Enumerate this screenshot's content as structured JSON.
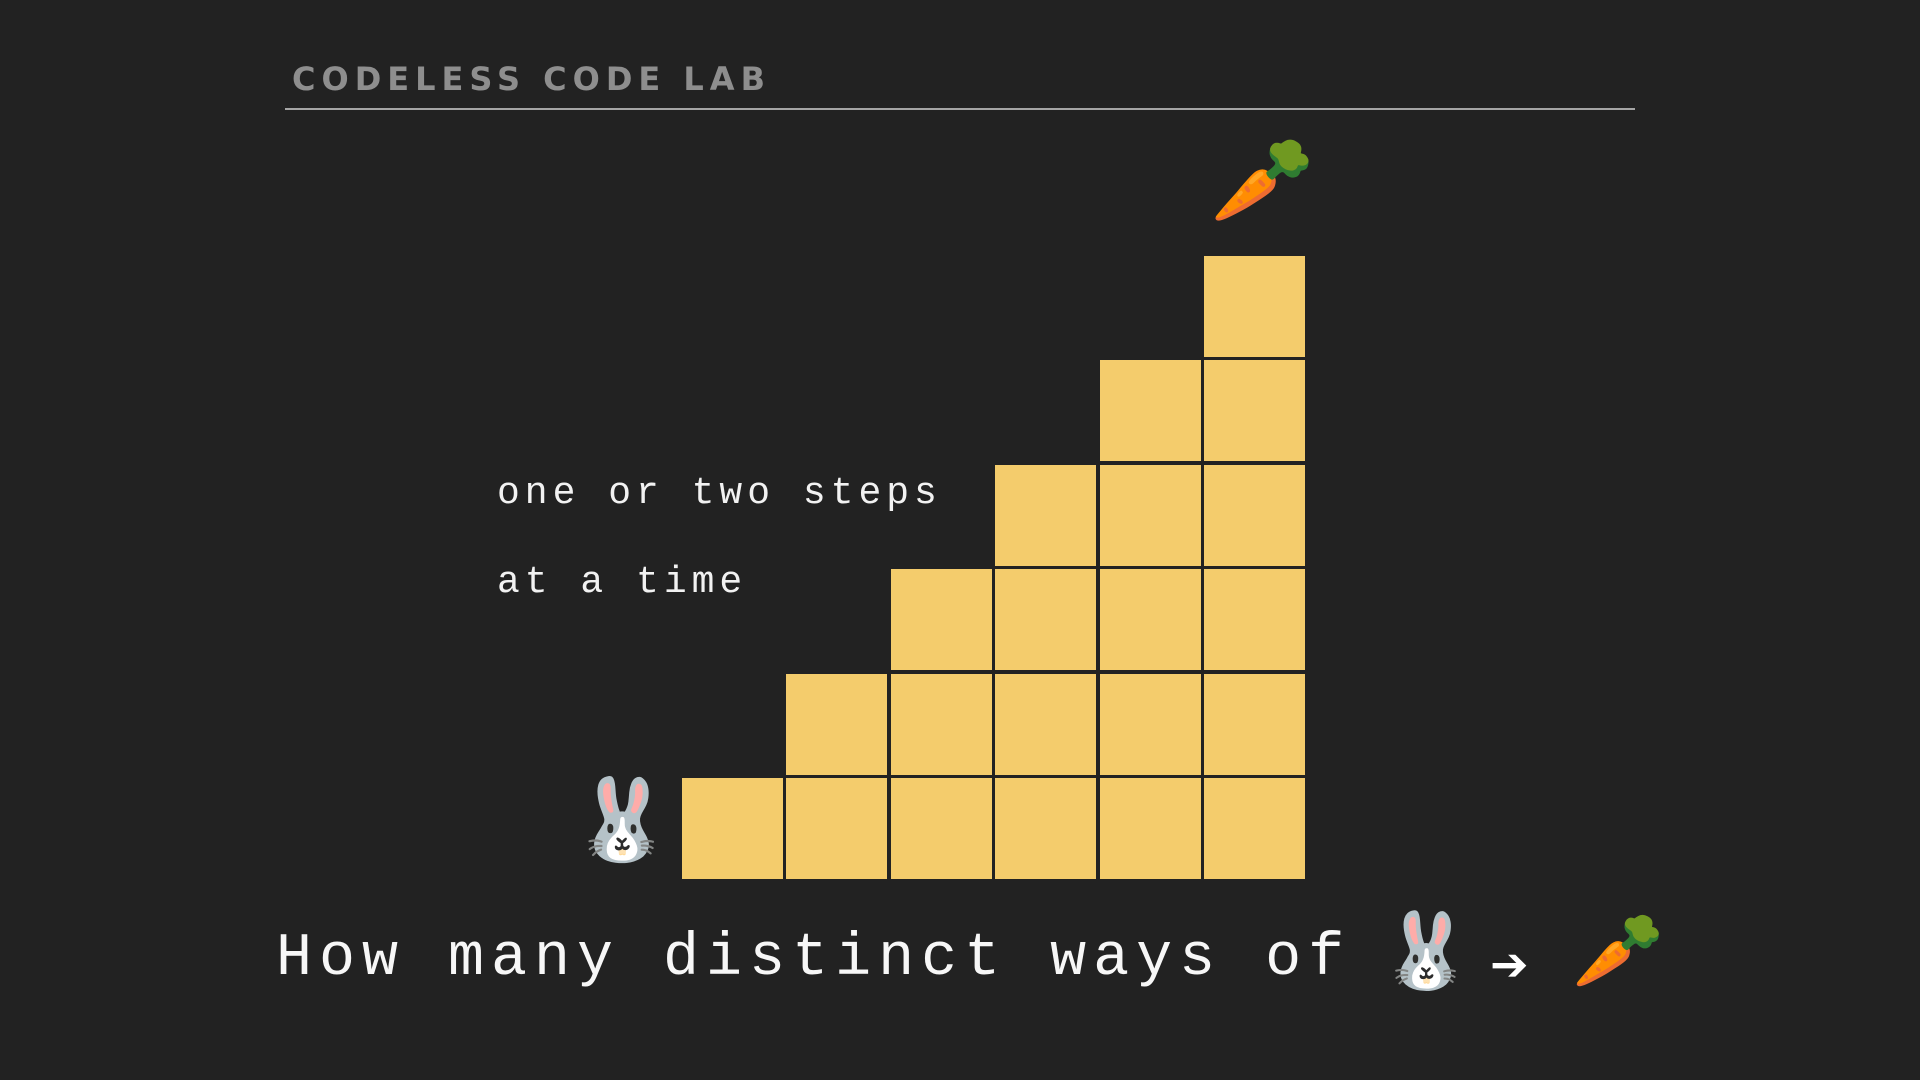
{
  "header": {
    "title": "CODELESS CODE LAB"
  },
  "caption": {
    "line1": "one or two steps",
    "line2": "at a time"
  },
  "staircase": {
    "columns": [
      1,
      2,
      3,
      4,
      5,
      6
    ],
    "block_color": "#f4cc6c",
    "background_color": "#222222"
  },
  "start_emoji": "🐰",
  "goal_emoji": "🥕",
  "question": {
    "text": "How many distinct ways of",
    "from_emoji": "🐰",
    "arrow": "➔",
    "to_emoji": "🥕"
  }
}
